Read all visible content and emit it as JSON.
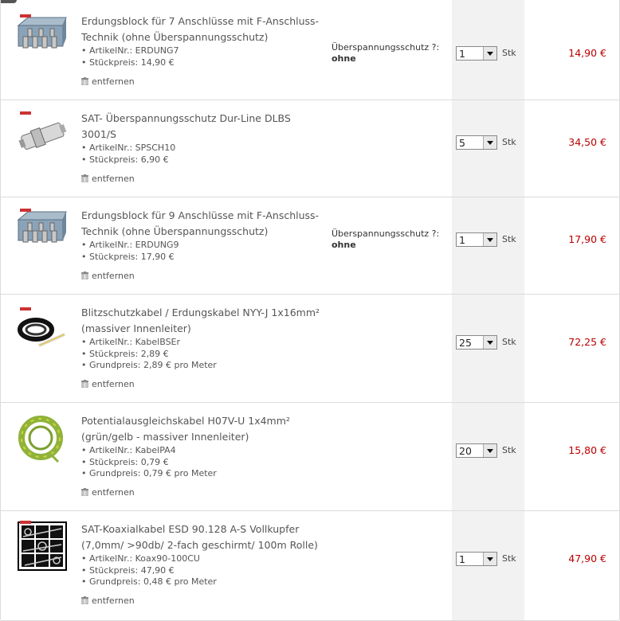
{
  "items": [
    {
      "title": "Erdungsblock für 7 Anschlüsse mit F-Anschluss-Technik (ohne Überspannungsschutz)",
      "details": [
        "• ArtikelNr.: ERDUNG7",
        "• Stückpreis: 14,90 €"
      ],
      "remove_label": "entfernen",
      "option_label": "Überspannungsschutz ?:",
      "option_value": "ohne",
      "quantity": "1",
      "unit": "Stk",
      "total": "14,90 €",
      "icon": "grounding-block-image"
    },
    {
      "title": "SAT- Überspannungsschutz Dur-Line DLBS 3001/S",
      "details": [
        "• ArtikelNr.: SPSCH10",
        "• Stückpreis: 6,90 €"
      ],
      "remove_label": "entfernen",
      "option_label": "",
      "option_value": "",
      "quantity": "5",
      "unit": "Stk",
      "total": "34,50 €",
      "icon": "surge-protector-image"
    },
    {
      "title": "Erdungsblock für 9 Anschlüsse mit F-Anschluss-Technik (ohne Überspannungsschutz)",
      "details": [
        "• ArtikelNr.: ERDUNG9",
        "• Stückpreis: 17,90 €"
      ],
      "remove_label": "entfernen",
      "option_label": "Überspannungsschutz ?:",
      "option_value": "ohne",
      "quantity": "1",
      "unit": "Stk",
      "total": "17,90 €",
      "icon": "grounding-block-image"
    },
    {
      "title": "Blitzschutzkabel / Erdungskabel NYY-J 1x16mm² (massiver Innenleiter)",
      "details": [
        "• ArtikelNr.: KabelBSEr",
        "• Stückpreis: 2,89 €",
        "• Grundpreis: 2,89 € pro Meter"
      ],
      "remove_label": "entfernen",
      "option_label": "",
      "option_value": "",
      "quantity": "25",
      "unit": "Stk",
      "total": "72,25 €",
      "icon": "black-cable-image"
    },
    {
      "title": "Potentialausgleichskabel H07V-U 1x4mm² (grün/gelb - massiver Innenleiter)",
      "details": [
        "• ArtikelNr.: KabelPA4",
        "• Stückpreis: 0,79 €",
        "• Grundpreis: 0,79 € pro Meter"
      ],
      "remove_label": "entfernen",
      "option_label": "",
      "option_value": "",
      "quantity": "20",
      "unit": "Stk",
      "total": "15,80 €",
      "icon": "green-yellow-cable-image"
    },
    {
      "title": "SAT-Koaxialkabel ESD 90.128 A-S Vollkupfer (7,0mm/ >90db/ 2-fach geschirmt/ 100m Rolle)",
      "details": [
        "• ArtikelNr.: Koax90-100CU",
        "• Stückpreis: 47,90 €",
        "• Grundpreis: 0,48 € pro Meter"
      ],
      "remove_label": "entfernen",
      "option_label": "",
      "option_value": "",
      "quantity": "1",
      "unit": "Stk",
      "total": "47,90 €",
      "icon": "coax-cable-image"
    }
  ]
}
